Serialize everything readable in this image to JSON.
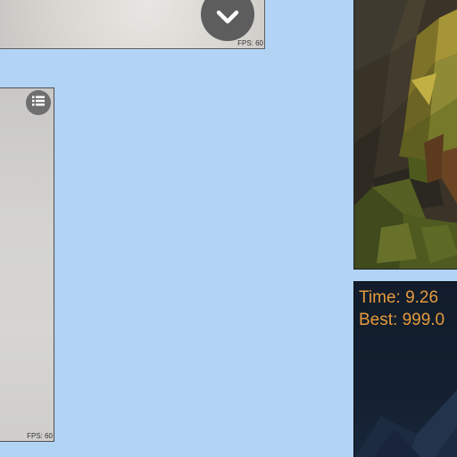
{
  "top_panel": {
    "fps_label": "FPS: 60",
    "button_icon": "chevron-down-icon"
  },
  "left_panel": {
    "fps_label": "FPS: 60",
    "button_icon": "list-icon"
  },
  "timer_panel": {
    "time_label": "Time: 9.26",
    "best_label": "Best: 999.0"
  },
  "colors": {
    "background": "#b1d3f4",
    "timer_text": "#e59a3b",
    "button_dark": "#5d5d5d"
  }
}
